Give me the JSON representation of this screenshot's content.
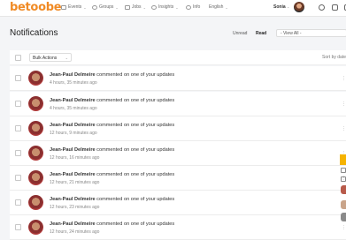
{
  "app": {
    "logo": "betoobe"
  },
  "topnav": {
    "items": [
      {
        "label": "Events",
        "icon": "calendar-icon"
      },
      {
        "label": "Groups",
        "icon": "groups-icon"
      },
      {
        "label": "Jobs",
        "icon": "briefcase-icon"
      },
      {
        "label": "Insights",
        "icon": "insights-icon"
      },
      {
        "label": "Info",
        "icon": "info-icon"
      },
      {
        "label": "English",
        "icon": ""
      }
    ],
    "user_name": "Sonia"
  },
  "page": {
    "title": "Notifications",
    "filters": {
      "unread": "Unread",
      "read": "Read"
    },
    "view_select": "- View All -"
  },
  "toolbar": {
    "bulk_actions": "Bulk Actions",
    "sort_by": "Sort by date"
  },
  "notifications": [
    {
      "actor": "Jean-Paul Delmeire",
      "text": " commented on one of your updates",
      "time": "4 hours, 35 minutes ago"
    },
    {
      "actor": "Jean-Paul Delmeire",
      "text": " commented on one of your updates",
      "time": "4 hours, 35 minutes ago"
    },
    {
      "actor": "Jean-Paul Delmeire",
      "text": " commented on one of your updates",
      "time": "12 hours, 9 minutes ago"
    },
    {
      "actor": "Jean-Paul Delmeire",
      "text": " commented on one of your updates",
      "time": "12 hours, 16 minutes ago"
    },
    {
      "actor": "Jean-Paul Delmeire",
      "text": " commented on one of your updates",
      "time": "12 hours, 21 minutes ago"
    },
    {
      "actor": "Jean-Paul Delmeire",
      "text": " commented on one of your updates",
      "time": "12 hours, 23 minutes ago"
    },
    {
      "actor": "Jean-Paul Delmeire",
      "text": " commented on one of your updates",
      "time": "12 hours, 24 minutes ago"
    }
  ],
  "colors": {
    "brand": "#f08a24",
    "accent": "#f5b301"
  }
}
